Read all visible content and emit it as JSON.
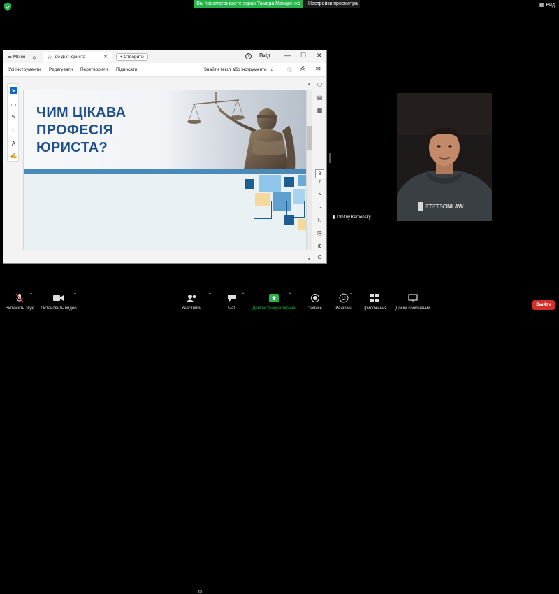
{
  "banner": {
    "share_text": "Вы просматриваете экран Тамара Макаренко",
    "view_settings": "Настройки просмотра",
    "view_button": "Вид"
  },
  "app": {
    "menu_label": "Меню",
    "tab_title": "до дня юриста",
    "create_label": "Створити",
    "login_label": "Вхід",
    "menubar": {
      "all_tools": "Усі інструменти",
      "edit": "Редагувати",
      "convert": "Перетворити",
      "sign": "Підписати",
      "find_tools": "Знайти текст або інструменти"
    },
    "page_number": "3",
    "page_total": "7"
  },
  "document": {
    "title_line1": "ЧИМ ЦІКАВА",
    "title_line2": "ПРОФЕСІЯ",
    "title_line3": "ЮРИСТА?",
    "title_color": "#1e4f86",
    "accent_bar_color": "#4a8ab8"
  },
  "participant": {
    "name": "Dmitriy Kamensky",
    "shirt_text": "STETSONLAW"
  },
  "toolbar": {
    "unmute": "Включить звук",
    "stop_video": "Остановить видео",
    "participants": "Участники",
    "participants_count": "25",
    "chat": "Чат",
    "share_screen": "Демонстрация экрана",
    "record": "Запись",
    "reactions": "Реакции",
    "apps": "Приложения",
    "whiteboards": "Доски сообщений",
    "leave": "Выйти"
  },
  "colors": {
    "share_green": "#25b34a",
    "leave_red": "#d2302b",
    "active_tool_blue": "#1565c0"
  }
}
